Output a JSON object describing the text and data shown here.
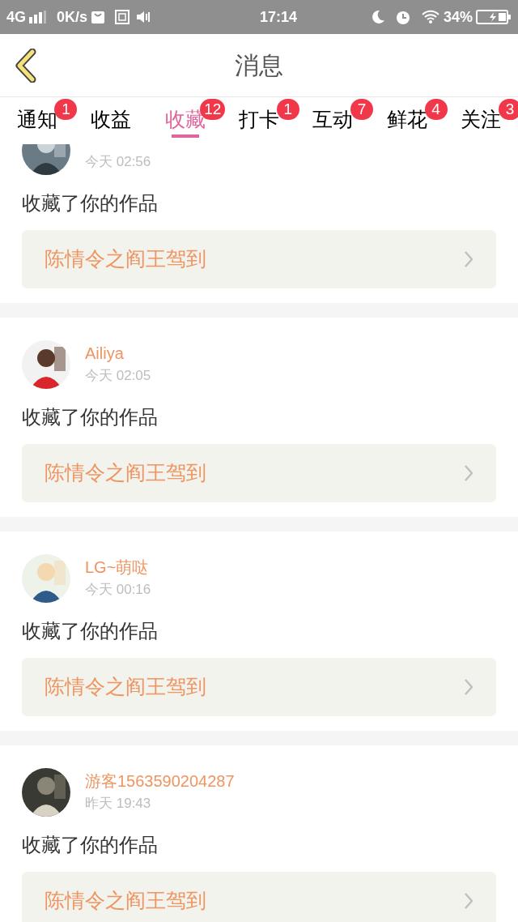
{
  "status_bar": {
    "network": "4G",
    "speed": "0K/s",
    "time": "17:14",
    "battery": "34%"
  },
  "header": {
    "title": "消息"
  },
  "tabs": [
    {
      "label": "通知",
      "badge": "1",
      "selected": false
    },
    {
      "label": "收益",
      "selected": false
    },
    {
      "label": "收藏",
      "badge": "12",
      "selected": true
    },
    {
      "label": "打卡",
      "badge": "1",
      "selected": false
    },
    {
      "label": "互动",
      "badge": "7",
      "selected": false
    },
    {
      "label": "鲜花",
      "badge": "4",
      "selected": false
    },
    {
      "label": "关注",
      "badge": "3",
      "selected": false
    }
  ],
  "messages": [
    {
      "time": "今天 02:56",
      "text": "收藏了你的作品",
      "work": "陈情令之阎王驾到"
    },
    {
      "user": "Ailiya",
      "time": "今天 02:05",
      "text": "收藏了你的作品",
      "work": "陈情令之阎王驾到"
    },
    {
      "user": "LG~萌哒",
      "time": "今天 00:16",
      "text": "收藏了你的作品",
      "work": "陈情令之阎王驾到"
    },
    {
      "user": "游客1563590204287",
      "time": "昨天 19:43",
      "text": "收藏了你的作品",
      "work": "陈情令之阎王驾到"
    }
  ]
}
